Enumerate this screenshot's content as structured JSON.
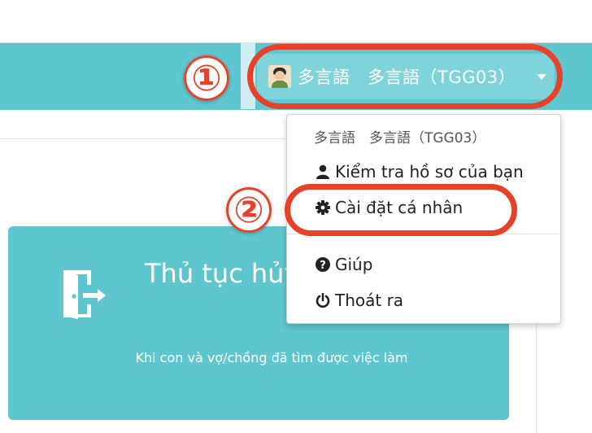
{
  "header": {
    "user_name": "多言語　多言語（TGG03）"
  },
  "dropdown": {
    "header": "多言語　多言語（TGG03）",
    "items": [
      {
        "label": "Kiểm tra hồ sơ của bạn",
        "icon": "user-icon"
      },
      {
        "label": "Cài đặt cá nhân",
        "icon": "gear-icon"
      },
      {
        "label": "Giúp",
        "icon": "question-circle-icon"
      },
      {
        "label": "Thoát ra",
        "icon": "power-icon"
      }
    ]
  },
  "card": {
    "title": "Thủ tục hủy thuộc",
    "description": "Khi con và vợ/chồng đã tìm được việc làm",
    "icon": "exit-door-icon"
  },
  "steps": [
    "①",
    "②"
  ],
  "colors": {
    "accent": "#5ec6cf",
    "highlight": "#e8412a"
  }
}
